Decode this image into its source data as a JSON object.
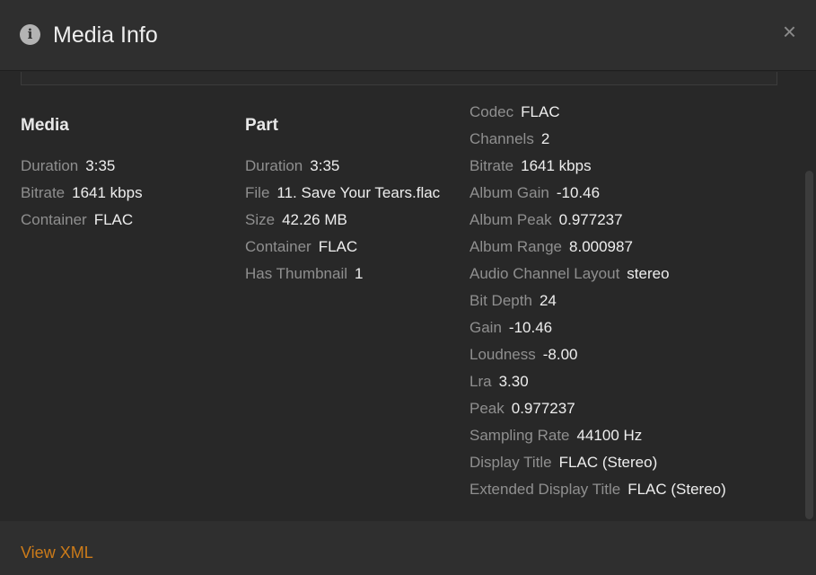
{
  "header": {
    "title": "Media Info",
    "info_icon": "i",
    "close_icon": "×"
  },
  "media": {
    "heading": "Media",
    "rows": [
      {
        "label": "Duration",
        "value": "3:35"
      },
      {
        "label": "Bitrate",
        "value": "1641 kbps"
      },
      {
        "label": "Container",
        "value": "FLAC"
      }
    ]
  },
  "part": {
    "heading": "Part",
    "rows": [
      {
        "label": "Duration",
        "value": "3:35"
      },
      {
        "label": "File",
        "value": "11. Save Your Tears.flac"
      },
      {
        "label": "Size",
        "value": "42.26 MB"
      },
      {
        "label": "Container",
        "value": "FLAC"
      },
      {
        "label": "Has Thumbnail",
        "value": "1"
      }
    ]
  },
  "stream": {
    "rows": [
      {
        "label": "Codec",
        "value": "FLAC"
      },
      {
        "label": "Channels",
        "value": "2"
      },
      {
        "label": "Bitrate",
        "value": "1641 kbps"
      },
      {
        "label": "Album Gain",
        "value": "-10.46"
      },
      {
        "label": "Album Peak",
        "value": "0.977237"
      },
      {
        "label": "Album Range",
        "value": "8.000987"
      },
      {
        "label": "Audio Channel Layout",
        "value": "stereo"
      },
      {
        "label": "Bit Depth",
        "value": "24"
      },
      {
        "label": "Gain",
        "value": "-10.46"
      },
      {
        "label": "Loudness",
        "value": "-8.00"
      },
      {
        "label": "Lra",
        "value": "3.30"
      },
      {
        "label": "Peak",
        "value": "0.977237"
      },
      {
        "label": "Sampling Rate",
        "value": "44100 Hz"
      },
      {
        "label": "Display Title",
        "value": "FLAC (Stereo)"
      },
      {
        "label": "Extended Display Title",
        "value": "FLAC (Stereo)"
      }
    ]
  },
  "footer": {
    "view_xml_label": "View XML"
  },
  "colors": {
    "accent": "#cc7b19",
    "background": "#282828",
    "header_bg": "#2f2f2f",
    "label": "#8f8f8f",
    "value": "#eeeeee"
  }
}
